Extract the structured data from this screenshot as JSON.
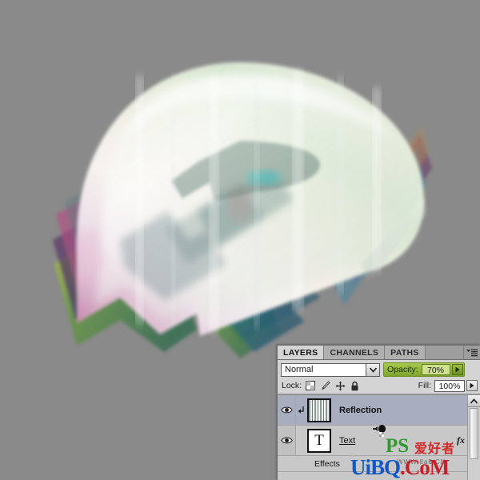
{
  "canvas": {
    "background_color": "#8a8a8a",
    "artwork_description": "3D extruded translucent iridescent numeral 2"
  },
  "panel": {
    "tabs": [
      {
        "label": "LAYERS",
        "active": true
      },
      {
        "label": "CHANNELS",
        "active": false
      },
      {
        "label": "PATHS",
        "active": false
      }
    ],
    "menu_icon": "panel-menu-icon",
    "blend_mode": {
      "label": "Normal",
      "arrow_icon": "chevron-down-icon"
    },
    "opacity": {
      "label": "Opacity:",
      "value": "70%",
      "arrow_icon": "triangle-right-icon",
      "highlight_color": "#8fb53a"
    },
    "lock": {
      "label": "Lock:",
      "icons": [
        "lock-transparent-pixels-icon",
        "lock-image-pixels-icon",
        "lock-position-icon",
        "lock-all-icon"
      ]
    },
    "fill": {
      "label": "Fill:",
      "value": "100%",
      "arrow_icon": "triangle-right-icon"
    },
    "layers": [
      {
        "name": "Reflection",
        "visible": true,
        "selected": true,
        "clipped": true,
        "thumbnail": "striped-reflection-thumbnail",
        "eye_icon": "eye-icon",
        "clip_icon": "clipping-mask-arrow-icon"
      },
      {
        "name": "Text",
        "visible": true,
        "selected": false,
        "clipped": false,
        "thumbnail": "text-layer-T-thumbnail",
        "eye_icon": "eye-icon",
        "fx_icon": "fx-icon",
        "expand_icon": "triangle-up-icon",
        "sub_rows": [
          {
            "label": "Effects"
          }
        ]
      }
    ],
    "scrollbar": {
      "up_arrow_icon": "chevron-up-icon",
      "thumb": "scrollbar-thumb"
    }
  },
  "cursor": {
    "icon": "brush-cursor-icon"
  },
  "watermark": {
    "part1": "UiBQ",
    "part2": ".CoM",
    "logo": "PS",
    "chinese": "爱好者",
    "sub": "WWW.8a8.CN"
  }
}
